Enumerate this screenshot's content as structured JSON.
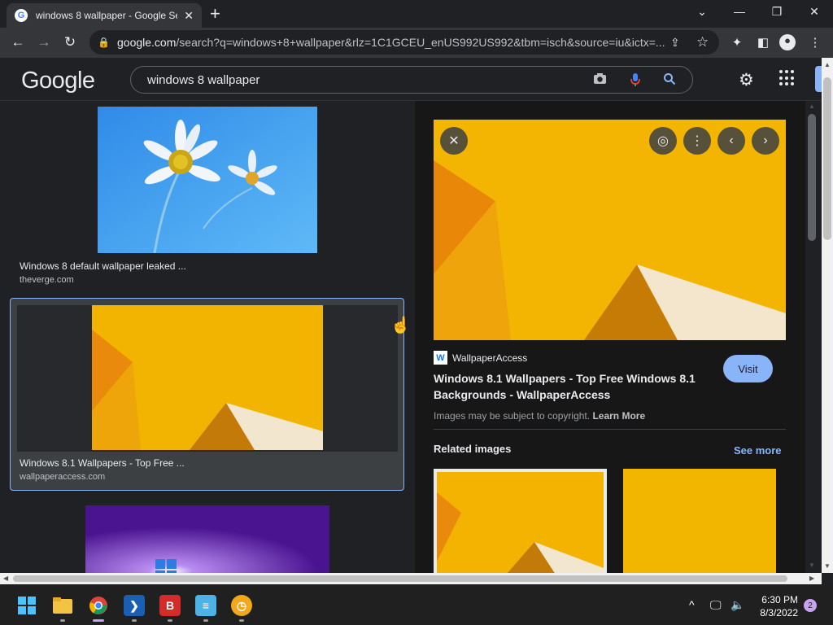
{
  "browser": {
    "tab_title": "windows 8 wallpaper - Google Se",
    "favicon_letter": "G",
    "new_tab": "+",
    "url_host": "google.com",
    "url_rest": "/search?q=windows+8+wallpaper&rlz=1C1GCEU_enUS992US992&tbm=isch&source=iu&ictx=..."
  },
  "google": {
    "logo": "Google",
    "query": "windows 8 wallpaper"
  },
  "results": [
    {
      "caption": "Windows 8 default wallpaper leaked ...",
      "source": "theverge.com"
    },
    {
      "caption": "Windows 8.1 Wallpapers - Top Free ...",
      "source": "wallpaperaccess.com"
    }
  ],
  "preview": {
    "site_logo": "W",
    "site_name": "WallpaperAccess",
    "title": "Windows 8.1 Wallpapers - Top Free Windows 8.1 Backgrounds - WallpaperAccess",
    "visit_label": "Visit",
    "copyright_prefix": "Images may be subject to copyright.",
    "learn_more": "Learn More",
    "related_title": "Related images",
    "see_more": "See more"
  },
  "taskbar": {
    "time": "6:30 PM",
    "date": "8/3/2022",
    "notifications": "2"
  },
  "colors": {
    "accent": "#8ab4f8",
    "wallpaper_yellow": "#f5b800",
    "wallpaper_orange": "#e8890a",
    "wallpaper_blue": "#3aa0f2",
    "wallpaper_purple": "#6a1fa8"
  }
}
